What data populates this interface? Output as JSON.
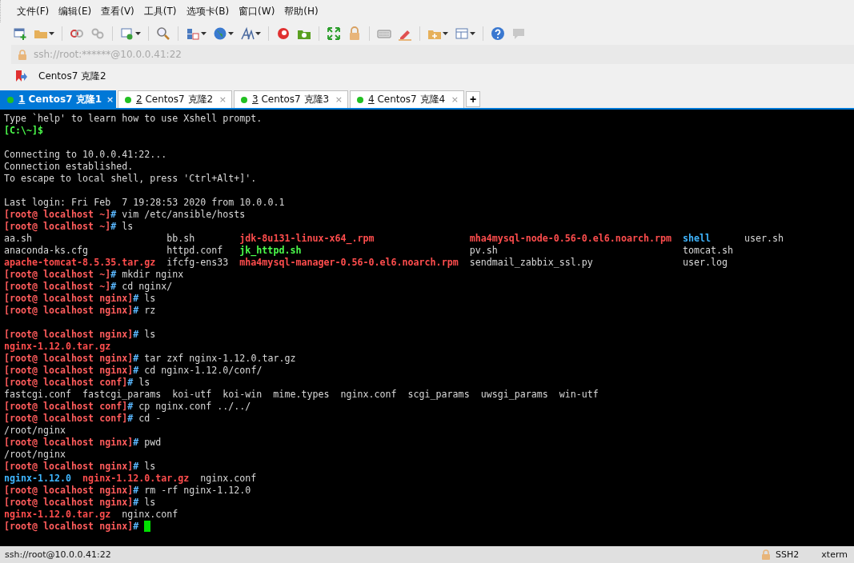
{
  "menu": [
    "文件(F)",
    "编辑(E)",
    "查看(V)",
    "工具(T)",
    "选项卡(B)",
    "窗口(W)",
    "帮助(H)"
  ],
  "address": {
    "text": "ssh://root:******@10.0.0.41:22"
  },
  "bookmarks": [
    {
      "label": "Centos7 克隆2"
    }
  ],
  "tabs": [
    {
      "number": "1",
      "label": " Centos7 克隆1",
      "close": "×",
      "selected": true
    },
    {
      "number": "2",
      "label": " Centos7 克隆2",
      "close": "×",
      "selected": false
    },
    {
      "number": "3",
      "label": " Centos7 克隆3",
      "close": "×",
      "selected": false
    },
    {
      "number": "4",
      "label": " Centos7 克隆4",
      "close": "×",
      "selected": false
    }
  ],
  "new_tab": "+",
  "terminal": [
    {
      "kind": "text",
      "text": "Type `help' to learn how to use Xshell prompt.",
      "color": "#d8d8d8"
    },
    {
      "kind": "text",
      "text": "[C:\\~]$",
      "color": "#4cff4c"
    },
    {
      "kind": "blank"
    },
    {
      "kind": "text",
      "text": "Connecting to 10.0.0.41:22...",
      "color": "#d8d8d8"
    },
    {
      "kind": "text",
      "text": "Connection established.",
      "color": "#d8d8d8"
    },
    {
      "kind": "text",
      "text": "To escape to local shell, press 'Ctrl+Alt+]'.",
      "color": "#d8d8d8"
    },
    {
      "kind": "blank"
    },
    {
      "kind": "text",
      "text": "Last login: Fri Feb  7 19:28:53 2020 from 10.0.0.1",
      "color": "#d8d8d8"
    },
    {
      "kind": "prompt",
      "prompt": "[root@ localhost ~]",
      "sign": "#",
      "command": "vim /etc/ansible/hosts",
      "cursor": false
    },
    {
      "kind": "prompt",
      "prompt": "[root@ localhost ~]",
      "sign": "#",
      "command": "ls",
      "cursor": false
    },
    {
      "kind": "ls",
      "cells": [
        {
          "text": "aa.sh",
          "color": "#d8d8d8"
        },
        {
          "text": "bb.sh",
          "color": "#d8d8d8"
        },
        {
          "text": "jdk-8u131-linux-x64_.rpm",
          "color": "#ff4d4d"
        },
        {
          "text": "mha4mysql-node-0.56-0.el6.noarch.rpm",
          "color": "#ff4d4d"
        },
        {
          "text": "shell",
          "color": "#3fb6ff"
        },
        {
          "text": "user.sh",
          "color": "#d8d8d8"
        }
      ]
    },
    {
      "kind": "ls",
      "cells": [
        {
          "text": "anaconda-ks.cfg",
          "color": "#d8d8d8"
        },
        {
          "text": "httpd.conf",
          "color": "#d8d8d8"
        },
        {
          "text": "jk_httpd.sh",
          "color": "#4cff4c"
        },
        {
          "text": "pv.sh",
          "color": "#d8d8d8"
        },
        {
          "text": "tomcat.sh",
          "color": "#d8d8d8"
        }
      ]
    },
    {
      "kind": "ls",
      "cells": [
        {
          "text": "apache-tomcat-8.5.35.tar.gz",
          "color": "#ff4d4d"
        },
        {
          "text": "ifcfg-ens33",
          "color": "#d8d8d8"
        },
        {
          "text": "mha4mysql-manager-0.56-0.el6.noarch.rpm",
          "color": "#ff4d4d"
        },
        {
          "text": "sendmail_zabbix_ssl.py",
          "color": "#d8d8d8"
        },
        {
          "text": "user.log",
          "color": "#d8d8d8"
        }
      ]
    },
    {
      "kind": "prompt",
      "prompt": "[root@ localhost ~]",
      "sign": "#",
      "command": "mkdir nginx",
      "cursor": false
    },
    {
      "kind": "prompt",
      "prompt": "[root@ localhost ~]",
      "sign": "#",
      "command": "cd nginx/",
      "cursor": false
    },
    {
      "kind": "prompt",
      "prompt": "[root@ localhost nginx]",
      "sign": "#",
      "command": "ls",
      "cursor": false
    },
    {
      "kind": "prompt",
      "prompt": "[root@ localhost nginx]",
      "sign": "#",
      "command": "rz",
      "cursor": false
    },
    {
      "kind": "blank"
    },
    {
      "kind": "prompt",
      "prompt": "[root@ localhost nginx]",
      "sign": "#",
      "command": "ls",
      "cursor": false
    },
    {
      "kind": "ls",
      "cells": [
        {
          "text": "nginx-1.12.0.tar.gz",
          "color": "#ff4d4d"
        }
      ]
    },
    {
      "kind": "prompt",
      "prompt": "[root@ localhost nginx]",
      "sign": "#",
      "command": "tar zxf nginx-1.12.0.tar.gz",
      "cursor": false
    },
    {
      "kind": "prompt",
      "prompt": "[root@ localhost nginx]",
      "sign": "#",
      "command": "cd nginx-1.12.0/conf/",
      "cursor": false
    },
    {
      "kind": "prompt",
      "prompt": "[root@ localhost conf]",
      "sign": "#",
      "command": "ls",
      "cursor": false
    },
    {
      "kind": "ls",
      "cells": [
        {
          "text": "fastcgi.conf",
          "color": "#d8d8d8"
        },
        {
          "text": "fastcgi_params",
          "color": "#d8d8d8"
        },
        {
          "text": "koi-utf",
          "color": "#d8d8d8"
        },
        {
          "text": "koi-win",
          "color": "#d8d8d8"
        },
        {
          "text": "mime.types",
          "color": "#d8d8d8"
        },
        {
          "text": "nginx.conf",
          "color": "#d8d8d8"
        },
        {
          "text": "scgi_params",
          "color": "#d8d8d8"
        },
        {
          "text": "uwsgi_params",
          "color": "#d8d8d8"
        },
        {
          "text": "win-utf",
          "color": "#d8d8d8"
        }
      ]
    },
    {
      "kind": "prompt",
      "prompt": "[root@ localhost conf]",
      "sign": "#",
      "command": "cp nginx.conf ../../",
      "cursor": false
    },
    {
      "kind": "prompt",
      "prompt": "[root@ localhost conf]",
      "sign": "#",
      "command": "cd -",
      "cursor": false
    },
    {
      "kind": "text",
      "text": "/root/nginx",
      "color": "#d8d8d8"
    },
    {
      "kind": "prompt",
      "prompt": "[root@ localhost nginx]",
      "sign": "#",
      "command": "pwd",
      "cursor": false
    },
    {
      "kind": "text",
      "text": "/root/nginx",
      "color": "#d8d8d8"
    },
    {
      "kind": "prompt",
      "prompt": "[root@ localhost nginx]",
      "sign": "#",
      "command": "ls",
      "cursor": false
    },
    {
      "kind": "ls",
      "cells": [
        {
          "text": "nginx-1.12.0",
          "color": "#3fb6ff"
        },
        {
          "text": "nginx-1.12.0.tar.gz",
          "color": "#ff4d4d"
        },
        {
          "text": "nginx.conf",
          "color": "#d8d8d8"
        }
      ]
    },
    {
      "kind": "prompt",
      "prompt": "[root@ localhost nginx]",
      "sign": "#",
      "command": "rm -rf nginx-1.12.0",
      "cursor": false
    },
    {
      "kind": "prompt",
      "prompt": "[root@ localhost nginx]",
      "sign": "#",
      "command": "ls",
      "cursor": false
    },
    {
      "kind": "ls",
      "cells": [
        {
          "text": "nginx-1.12.0.tar.gz",
          "color": "#ff4d4d"
        },
        {
          "text": "nginx.conf",
          "color": "#d8d8d8"
        }
      ]
    },
    {
      "kind": "prompt",
      "prompt": "[root@ localhost nginx]",
      "sign": "#",
      "cursor": true
    }
  ],
  "status_bar": {
    "address": "ssh://root@10.0.0.41:22",
    "protocol": "SSH2",
    "terminal": "xterm"
  }
}
